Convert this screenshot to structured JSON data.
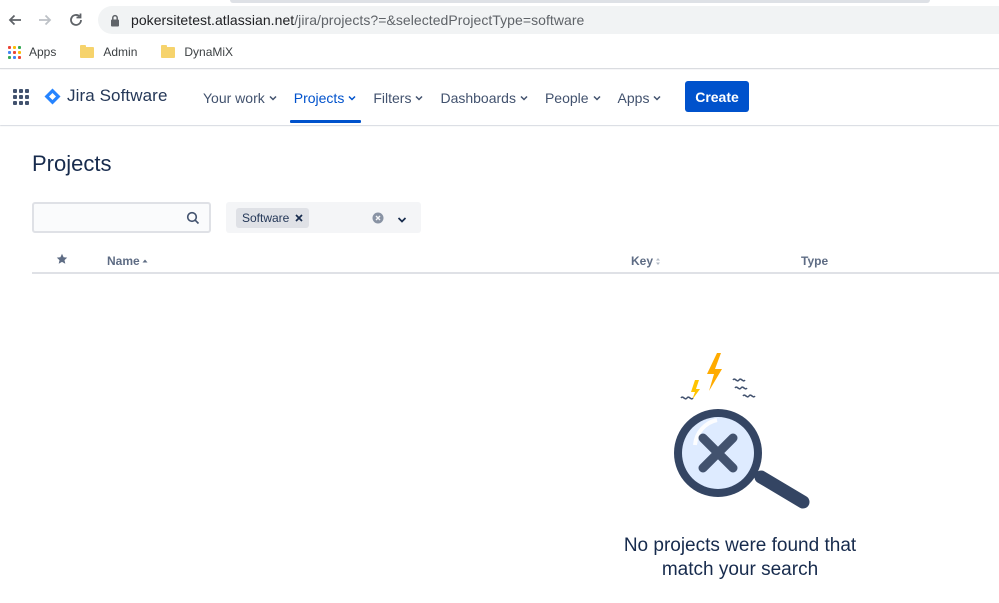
{
  "browser": {
    "url_host": "pokersitetest.atlassian.net",
    "url_path": "/jira/projects?=&selectedProjectType=software",
    "bookmarks": [
      {
        "label": "Apps",
        "icon": "apps-grid-icon"
      },
      {
        "label": "Admin",
        "icon": "folder-icon"
      },
      {
        "label": "DynaMiX",
        "icon": "folder-icon"
      }
    ]
  },
  "nav": {
    "product_name": "Jira Software",
    "items": [
      {
        "label": "Your work"
      },
      {
        "label": "Projects"
      },
      {
        "label": "Filters"
      },
      {
        "label": "Dashboards"
      },
      {
        "label": "People"
      },
      {
        "label": "Apps"
      }
    ],
    "create_label": "Create"
  },
  "page": {
    "title": "Projects",
    "search": {
      "value": "",
      "placeholder": ""
    },
    "filter": {
      "selected_tag": "Software"
    },
    "table": {
      "columns": [
        "Name",
        "Key",
        "Type"
      ]
    },
    "empty_state": {
      "line1": "No projects were found that",
      "line2": "match your search"
    }
  },
  "colors": {
    "primary": "#0052cc",
    "text": "#172b4d",
    "subtle": "#42526e"
  }
}
